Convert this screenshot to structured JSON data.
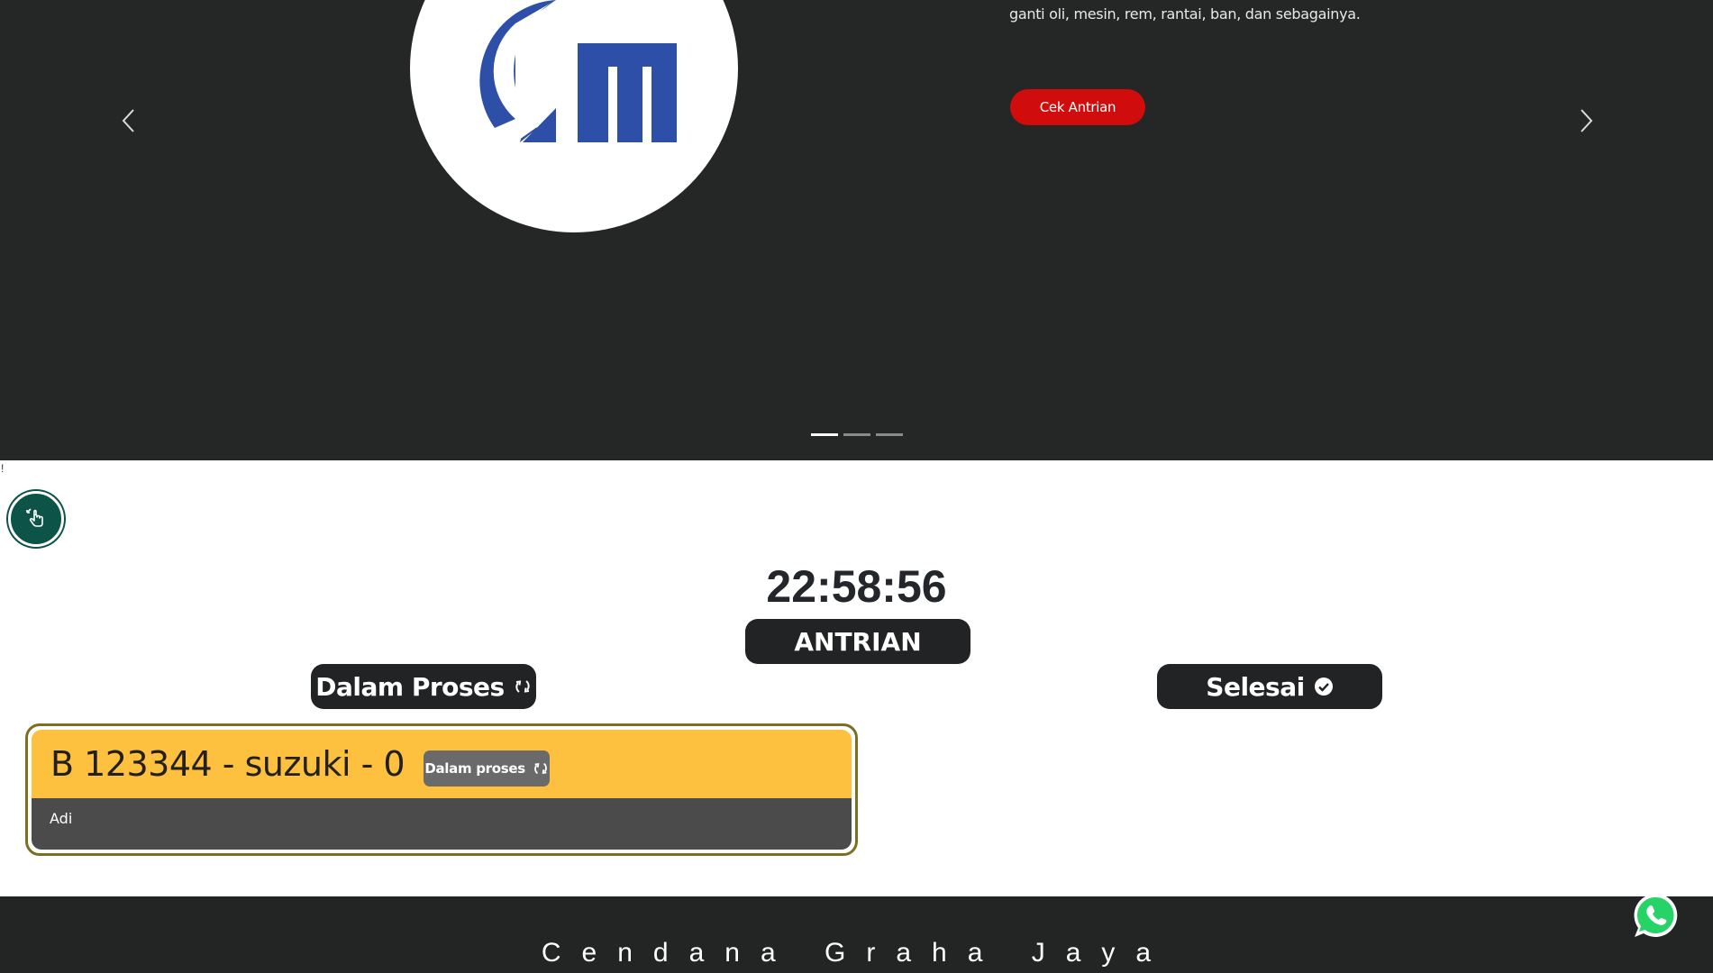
{
  "hero": {
    "description": "ganti oli, mesin, rem, rantai, ban, dan sebagainya.",
    "cta_label": "Cek Antrian",
    "indicators": 3
  },
  "page": {
    "stray_char": "!"
  },
  "queue": {
    "clock": "22:58:56",
    "title": "ANTRIAN",
    "in_progress_label": "Dalam Proses",
    "done_label": "Selesai",
    "items": [
      {
        "title": "B 123344 - suzuki - 0",
        "status": "Dalam proses",
        "mechanic": "Adi"
      }
    ]
  },
  "footer": {
    "brand": "Cendana Graha Jaya"
  },
  "colors": {
    "hero_bg": "#252626",
    "cta": "#d10c0c",
    "logo_blue": "#2d4fa8",
    "card_header": "#fdc03f",
    "card_body": "#4b4b4b",
    "pill": "#222324",
    "fab": "#0d5348",
    "whatsapp": "#25d366"
  },
  "icons": {
    "prev": "chevron-left-icon",
    "next": "chevron-right-icon",
    "in_progress": "refresh-icon",
    "done": "check-circle-icon",
    "fab": "hand-pointer-icon",
    "whatsapp": "whatsapp-icon"
  }
}
